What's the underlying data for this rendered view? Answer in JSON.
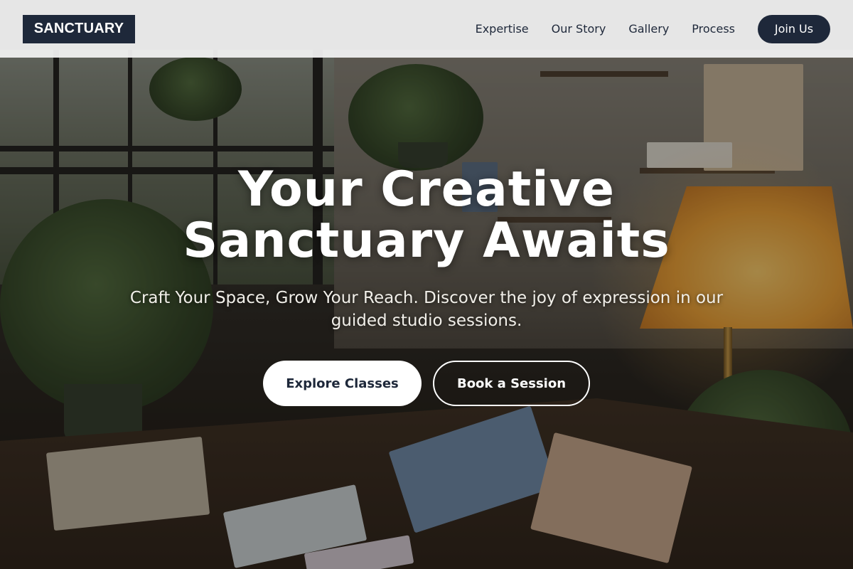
{
  "header": {
    "logo_text": "SANCTUARY",
    "nav": [
      {
        "label": "Expertise"
      },
      {
        "label": "Our Story"
      },
      {
        "label": "Gallery"
      },
      {
        "label": "Process"
      }
    ],
    "cta_label": "Join Us"
  },
  "hero": {
    "title_line1": "Your Creative",
    "title_line2": "Sanctuary Awaits",
    "subtitle": "Craft Your Space, Grow Your Reach. Discover the joy of expression in our guided studio sessions.",
    "primary_cta": "Explore Classes",
    "secondary_cta": "Book a Session"
  },
  "colors": {
    "brand_dark": "#1e283a",
    "header_bg": "#f2f2f2",
    "button_light": "#ffffff"
  }
}
